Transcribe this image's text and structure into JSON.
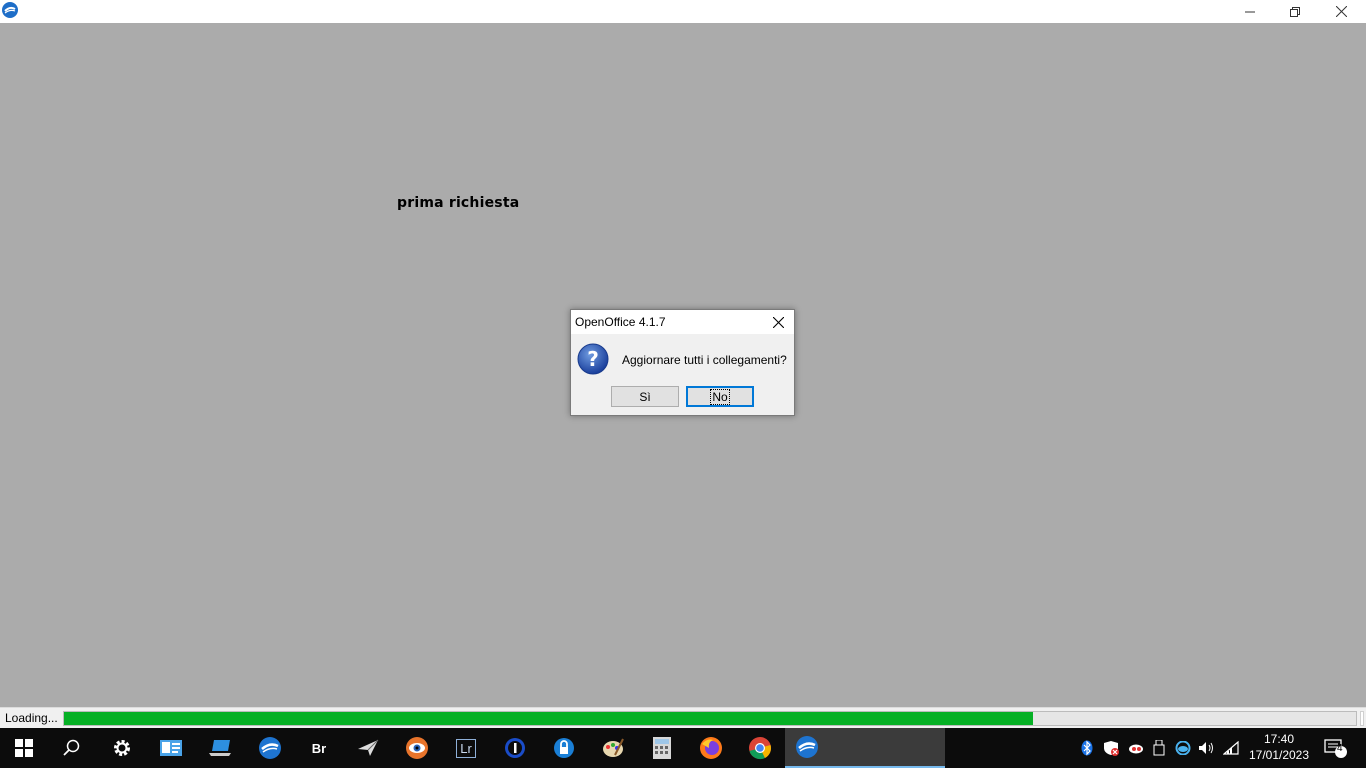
{
  "window": {
    "logo_icon": "openoffice-logo-icon",
    "controls": [
      "minimize-icon",
      "restore-icon",
      "close-icon"
    ]
  },
  "document": {
    "text": "prima richiesta"
  },
  "dialog": {
    "title": "OpenOffice 4.1.7",
    "icon": "question-icon",
    "message": "Aggiornare tutti i collegamenti?",
    "buttons": {
      "yes": "Sì",
      "no": "No"
    }
  },
  "status_bar": {
    "label": "Loading...",
    "progress_percent": 75
  },
  "taskbar": {
    "items": [
      "start-icon",
      "search-icon",
      "settings-icon",
      "contacts-icon",
      "pc-app-icon",
      "openoffice-icon",
      "bridge-icon",
      "paper-plane-icon",
      "eye-app-icon",
      "lightroom-icon",
      "onepassword-icon",
      "lock-app-icon",
      "paint-palette-icon",
      "calculator-icon",
      "firefox-icon",
      "chrome-icon",
      "openoffice-active-icon"
    ],
    "bridge_label": "Br",
    "lightroom_label": "Lr",
    "tray": [
      "bluetooth-icon",
      "security-icon",
      "cloud-sync-icon",
      "usb-icon",
      "onedrive-icon",
      "volume-icon",
      "network-icon"
    ],
    "time": "17:40",
    "date": "17/01/2023",
    "notifications_count": "4"
  },
  "colors": {
    "progress": "#06b025",
    "workspace": "#ababab",
    "focus": "#0078d7"
  }
}
